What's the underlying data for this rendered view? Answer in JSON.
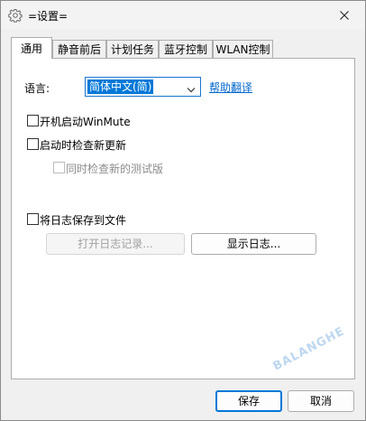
{
  "window": {
    "title": "=设置="
  },
  "tabs": [
    {
      "label": "通用",
      "active": true
    },
    {
      "label": "静音前后"
    },
    {
      "label": "计划任务"
    },
    {
      "label": "蓝牙控制"
    },
    {
      "label": "WLAN控制"
    }
  ],
  "general": {
    "language_label": "语言:",
    "language_value": "简体中文(简)",
    "help_translate_link": "帮助翻译",
    "autostart_label": "开机启动WinMute",
    "check_updates_label": "启动时检查新更新",
    "check_beta_label": "同时检查新的测试版",
    "save_log_label": "将日志保存到文件",
    "open_log_button": "打开日志记录...",
    "show_log_button": "显示日志..."
  },
  "footer": {
    "save_button": "保存",
    "cancel_button": "取消"
  },
  "watermark": {
    "text": "BALANGHE"
  },
  "colors": {
    "accent": "#0078d7",
    "link": "#0066cc"
  }
}
